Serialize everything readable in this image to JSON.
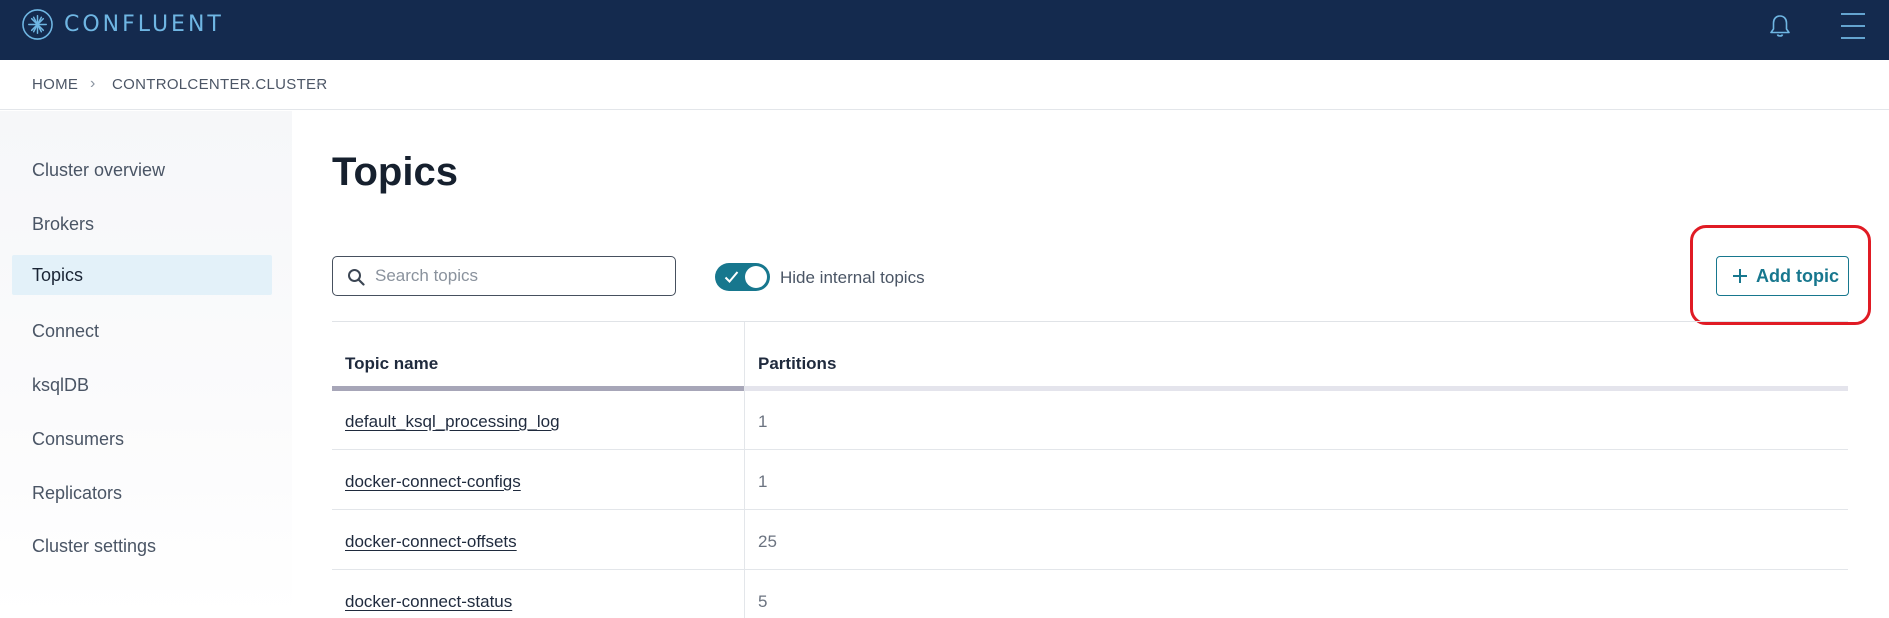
{
  "app": {
    "logo_text": "CONFLUENT"
  },
  "header": {
    "icons": [
      "bell-icon",
      "hamburger-menu-icon"
    ]
  },
  "breadcrumb": {
    "home": "HOME",
    "cluster": "CONTROLCENTER.CLUSTER"
  },
  "sidebar": {
    "items": [
      {
        "label": "Cluster overview"
      },
      {
        "label": "Brokers"
      },
      {
        "label": "Topics",
        "active": true
      },
      {
        "label": "Connect"
      },
      {
        "label": "ksqlDB"
      },
      {
        "label": "Consumers"
      },
      {
        "label": "Replicators"
      },
      {
        "label": "Cluster settings"
      }
    ]
  },
  "main": {
    "title": "Topics",
    "search": {
      "placeholder": "Search topics",
      "value": ""
    },
    "toggle": {
      "label": "Hide internal topics",
      "on": true
    },
    "add_button": {
      "label": "Add topic"
    },
    "table": {
      "columns": [
        "Topic name",
        "Partitions"
      ],
      "rows": [
        {
          "name": "default_ksql_processing_log",
          "partitions": "1"
        },
        {
          "name": "docker-connect-configs",
          "partitions": "1"
        },
        {
          "name": "docker-connect-offsets",
          "partitions": "25"
        },
        {
          "name": "docker-connect-status",
          "partitions": "5"
        }
      ]
    }
  },
  "colors": {
    "topbar": "#142a4e",
    "accent": "#17778e",
    "highlight": "#e01b24"
  }
}
